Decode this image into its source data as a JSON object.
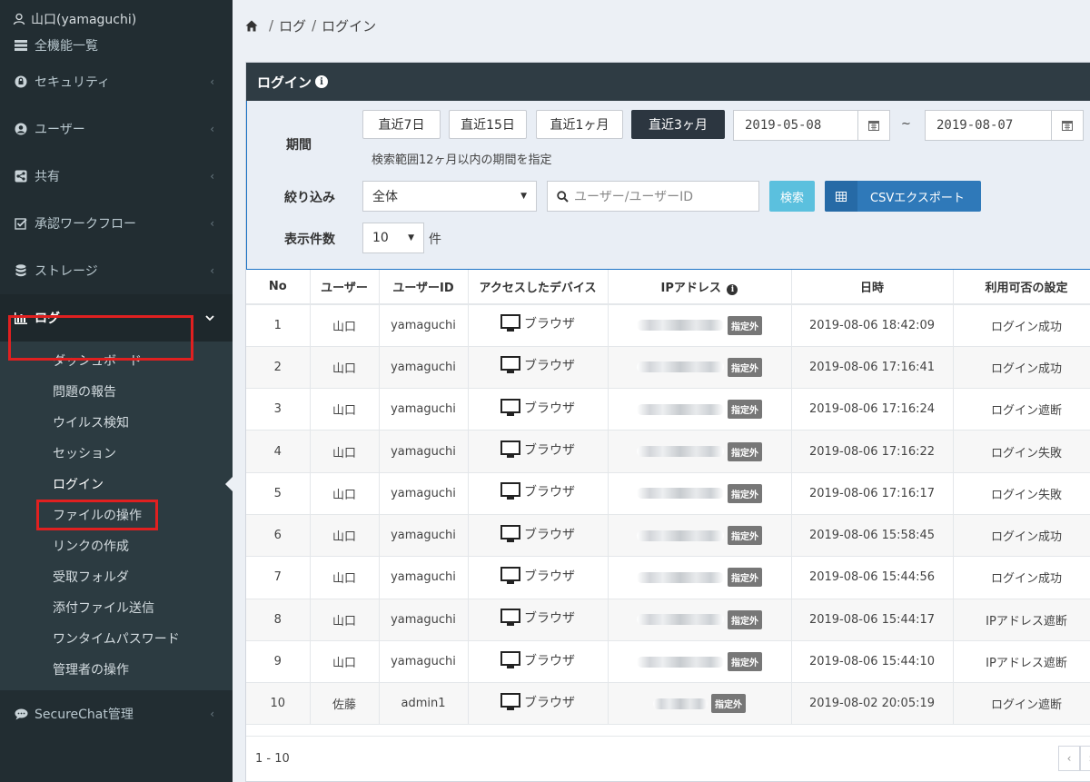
{
  "sidebar": {
    "user": "山口(yamaguchi)",
    "all_functions": "全機能一覧",
    "items": [
      {
        "label": "セキュリティ",
        "icon": "shield-icon"
      },
      {
        "label": "ユーザー",
        "icon": "user-icon"
      },
      {
        "label": "共有",
        "icon": "share-icon"
      },
      {
        "label": "承認ワークフロー",
        "icon": "check-icon"
      },
      {
        "label": "ストレージ",
        "icon": "database-icon"
      }
    ],
    "log_label": "ログ",
    "sub_items": [
      "ダッシュボード",
      "問題の報告",
      "ウイルス検知",
      "セッション",
      "ログイン",
      "ファイルの操作",
      "リンクの作成",
      "受取フォルダ",
      "添付ファイル送信",
      "ワンタイムパスワード",
      "管理者の操作"
    ],
    "active_sub": "ログイン",
    "chat_label": "SecureChat管理"
  },
  "breadcrumb": {
    "part1": "ログ",
    "part2": "ログイン",
    "sep": "/"
  },
  "panel": {
    "title": "ログイン"
  },
  "filter": {
    "period_label": "期間",
    "period_buttons": [
      "直近7日",
      "直近15日",
      "直近1ヶ月",
      "直近3ヶ月"
    ],
    "date_from": "2019-05-08",
    "tilde": "~",
    "date_to": "2019-08-07",
    "hint": "検索範囲12ヶ月以内の期間を指定",
    "narrow_label": "絞り込み",
    "narrow_value": "全体",
    "search_placeholder": "ユーザー/ユーザーID",
    "search_button": "検索",
    "csv_button": "CSVエクスポート",
    "count_label": "表示件数",
    "count_value": "10",
    "count_unit": "件"
  },
  "table": {
    "headers": [
      "No",
      "ユーザー",
      "ユーザーID",
      "アクセスしたデバイス",
      "IPアドレス",
      "日時",
      "利用可否の設定"
    ],
    "rows": [
      {
        "no": "1",
        "user": "山口",
        "uid": "yamaguchi",
        "device": "ブラウザ",
        "tag": "指定外",
        "date": "2019-08-06 18:42:09",
        "status": "ログイン成功"
      },
      {
        "no": "2",
        "user": "山口",
        "uid": "yamaguchi",
        "device": "ブラウザ",
        "tag": "指定外",
        "date": "2019-08-06 17:16:41",
        "status": "ログイン成功"
      },
      {
        "no": "3",
        "user": "山口",
        "uid": "yamaguchi",
        "device": "ブラウザ",
        "tag": "指定外",
        "date": "2019-08-06 17:16:24",
        "status": "ログイン遮断"
      },
      {
        "no": "4",
        "user": "山口",
        "uid": "yamaguchi",
        "device": "ブラウザ",
        "tag": "指定外",
        "date": "2019-08-06 17:16:22",
        "status": "ログイン失敗"
      },
      {
        "no": "5",
        "user": "山口",
        "uid": "yamaguchi",
        "device": "ブラウザ",
        "tag": "指定外",
        "date": "2019-08-06 17:16:17",
        "status": "ログイン失敗"
      },
      {
        "no": "6",
        "user": "山口",
        "uid": "yamaguchi",
        "device": "ブラウザ",
        "tag": "指定外",
        "date": "2019-08-06 15:58:45",
        "status": "ログイン成功"
      },
      {
        "no": "7",
        "user": "山口",
        "uid": "yamaguchi",
        "device": "ブラウザ",
        "tag": "指定外",
        "date": "2019-08-06 15:44:56",
        "status": "ログイン成功"
      },
      {
        "no": "8",
        "user": "山口",
        "uid": "yamaguchi",
        "device": "ブラウザ",
        "tag": "指定外",
        "date": "2019-08-06 15:44:17",
        "status": "IPアドレス遮断"
      },
      {
        "no": "9",
        "user": "山口",
        "uid": "yamaguchi",
        "device": "ブラウザ",
        "tag": "指定外",
        "date": "2019-08-06 15:44:10",
        "status": "IPアドレス遮断"
      },
      {
        "no": "10",
        "user": "佐藤",
        "uid": "admin1",
        "device": "ブラウザ",
        "tag": "指定外",
        "date": "2019-08-02 20:05:19",
        "status": "ログイン遮断"
      }
    ]
  },
  "footer": {
    "range": "1 - 10",
    "prev": "‹",
    "next": "›"
  },
  "colors": {
    "sidebar_bg": "#222d32",
    "highlight": "#e02020",
    "panel_header": "#2f3c44",
    "active_button": "#2c3640",
    "search_button": "#5bc0de",
    "csv_button": "#2f79b9"
  }
}
